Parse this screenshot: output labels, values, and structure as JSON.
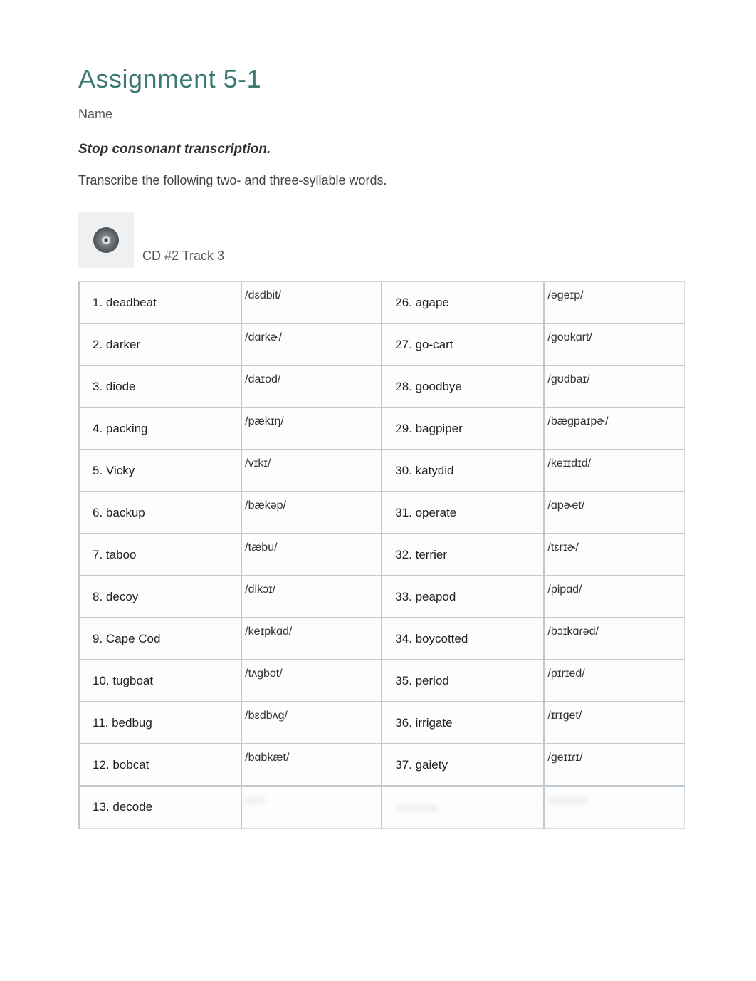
{
  "title": "Assignment 5-1",
  "name_label": "Name",
  "subheading": "Stop consonant transcription.",
  "instructions": "Transcribe the following two- and three-syllable words.",
  "cd_label": "CD #2 Track 3",
  "left": [
    {
      "n": "1.",
      "word": "deadbeat",
      "ipa": "/dɛdbit/"
    },
    {
      "n": "2.",
      "word": "darker",
      "ipa": "/dɑrkɚ/"
    },
    {
      "n": "3.",
      "word": "diode",
      "ipa": "/daɪod/"
    },
    {
      "n": "4.",
      "word": "packing",
      "ipa": "/pækɪŋ/"
    },
    {
      "n": "5.",
      "word": "Vicky",
      "ipa": "/vɪkɪ/"
    },
    {
      "n": "6.",
      "word": "backup",
      "ipa": "/bækəp/"
    },
    {
      "n": "7.",
      "word": "taboo",
      "ipa": "/tæbu/"
    },
    {
      "n": "8.",
      "word": "decoy",
      "ipa": "/dikɔɪ/"
    },
    {
      "n": "9.",
      "word": "Cape Cod",
      "ipa": "/keɪpkɑd/"
    },
    {
      "n": "10.",
      "word": "tugboat",
      "ipa": "/tʌgbot/"
    },
    {
      "n": "11.",
      "word": "bedbug",
      "ipa": "/bɛdbʌg/"
    },
    {
      "n": "12.",
      "word": "bobcat",
      "ipa": "/bɑbkæt/"
    },
    {
      "n": "13.",
      "word": "decode",
      "ipa": ""
    }
  ],
  "right": [
    {
      "n": "26.",
      "word": "agape",
      "ipa": "/əgeɪp/"
    },
    {
      "n": "27.",
      "word": "go-cart",
      "ipa": "/goʊkɑrt/"
    },
    {
      "n": "28.",
      "word": "goodbye",
      "ipa": "/gʊdbaɪ/"
    },
    {
      "n": "29.",
      "word": "bagpiper",
      "ipa": "/bægpaɪpɚ/"
    },
    {
      "n": "30.",
      "word": "katydid",
      "ipa": "/keɪɪdɪd/"
    },
    {
      "n": "31.",
      "word": "operate",
      "ipa": "/ɑpɚet/"
    },
    {
      "n": "32.",
      "word": "terrier",
      "ipa": "/tɛrɪɚ/"
    },
    {
      "n": "33.",
      "word": "peapod",
      "ipa": "/pipɑd/"
    },
    {
      "n": "34.",
      "word": "boycotted",
      "ipa": "/bɔɪkɑɾəd/"
    },
    {
      "n": "35.",
      "word": "period",
      "ipa": "/pɪrɪed/"
    },
    {
      "n": "36.",
      "word": "irrigate",
      "ipa": "/ɪrɪget/"
    },
    {
      "n": "37.",
      "word": "gaiety",
      "ipa": "/geɪɪɾɪ/"
    },
    {
      "n": "",
      "word": "",
      "ipa": ""
    }
  ]
}
